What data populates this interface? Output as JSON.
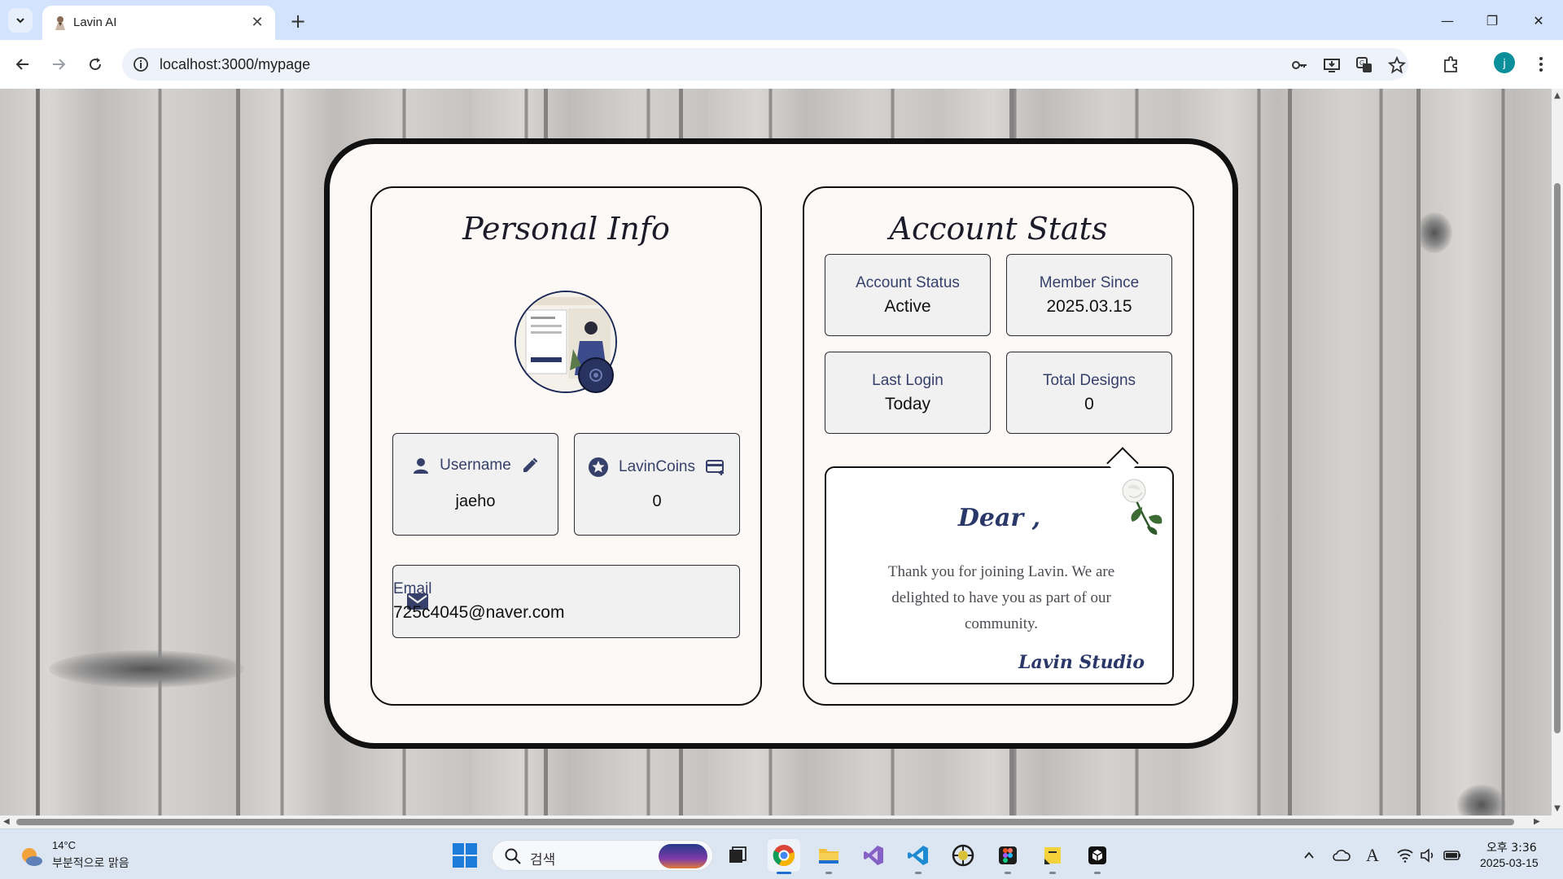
{
  "browser": {
    "tab_title": "Lavin AI",
    "tab_close_glyph": "✕",
    "new_tab_glyph": "+",
    "url": "localhost:3000/mypage",
    "profile_initial": "j",
    "window_controls": {
      "minimize": "—",
      "restore": "❐",
      "close": "✕"
    }
  },
  "personal_info": {
    "title": "Personal Info",
    "username": {
      "label": "Username",
      "value": "jaeho"
    },
    "coins": {
      "label": "LavinCoins",
      "value": "0"
    },
    "email": {
      "label": "Email",
      "value": "725c4045@naver.com"
    }
  },
  "account_stats": {
    "title": "Account Stats",
    "stats": [
      {
        "label": "Account Status",
        "value": "Active"
      },
      {
        "label": "Member Since",
        "value": "2025.03.15"
      },
      {
        "label": "Last Login",
        "value": "Today"
      },
      {
        "label": "Total Designs",
        "value": "0"
      }
    ]
  },
  "letter": {
    "greeting": "Dear ,",
    "body": "Thank you for joining Lavin. We are delighted to have you as part of our community.",
    "signature": "Lavin Studio"
  },
  "taskbar": {
    "weather_temp": "14°C",
    "weather_desc": "부분적으로 맑음",
    "search_placeholder": "검색",
    "clock_time": "오후 3:36",
    "clock_date": "2025-03-15",
    "tray_font_glyph": "A"
  },
  "colors": {
    "accent_navy": "#28335f",
    "label_blue": "#36406a",
    "card_bg": "#fdf9f6",
    "box_bg": "#f1f1f1",
    "tab_strip": "#d3e3fd"
  }
}
